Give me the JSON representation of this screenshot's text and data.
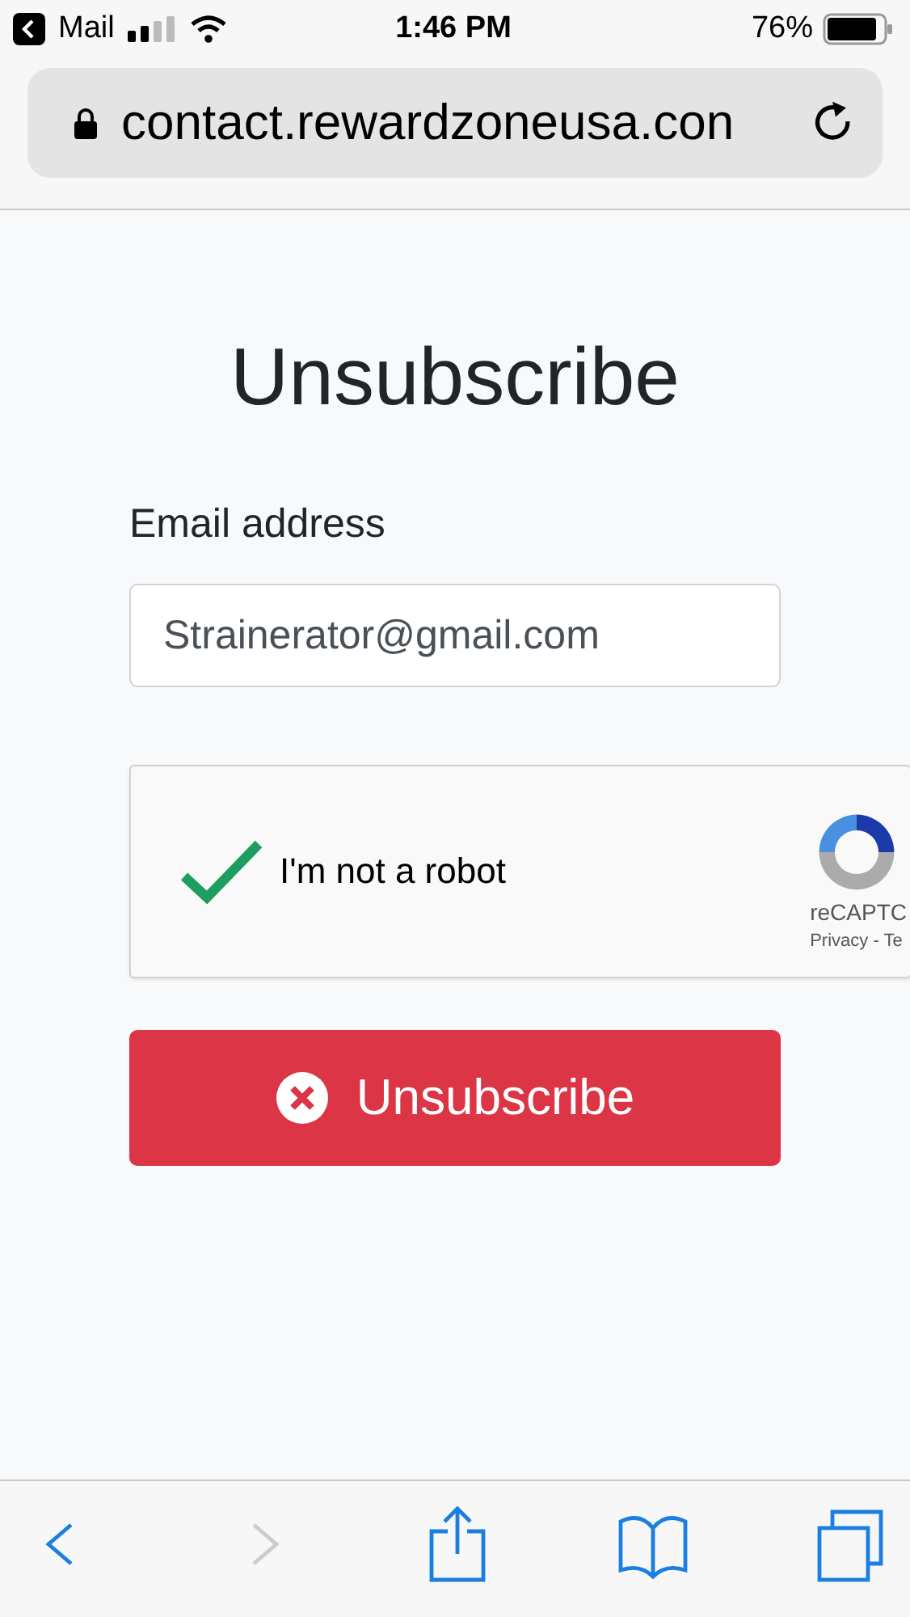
{
  "status_bar": {
    "back_app": "Mail",
    "time": "1:46 PM",
    "battery": "76%"
  },
  "address_bar": {
    "url": "contact.rewardzoneusa.con"
  },
  "title": "Unsubscribe",
  "email_field": {
    "label": "Email address",
    "value": "Strainerator@gmail.com"
  },
  "captcha": {
    "checked": true,
    "label": "I'm not a robot",
    "brand": "reCAPTC",
    "links": "Privacy - Te"
  },
  "submit_button": {
    "label": "Unsubscribe"
  },
  "toolbar": [
    {
      "kind": "back",
      "disabled": false
    },
    {
      "kind": "forward",
      "disabled": true
    },
    {
      "kind": "share",
      "disabled": false
    },
    {
      "kind": "bookmarks",
      "disabled": false
    },
    {
      "kind": "tabs",
      "disabled": false
    }
  ]
}
